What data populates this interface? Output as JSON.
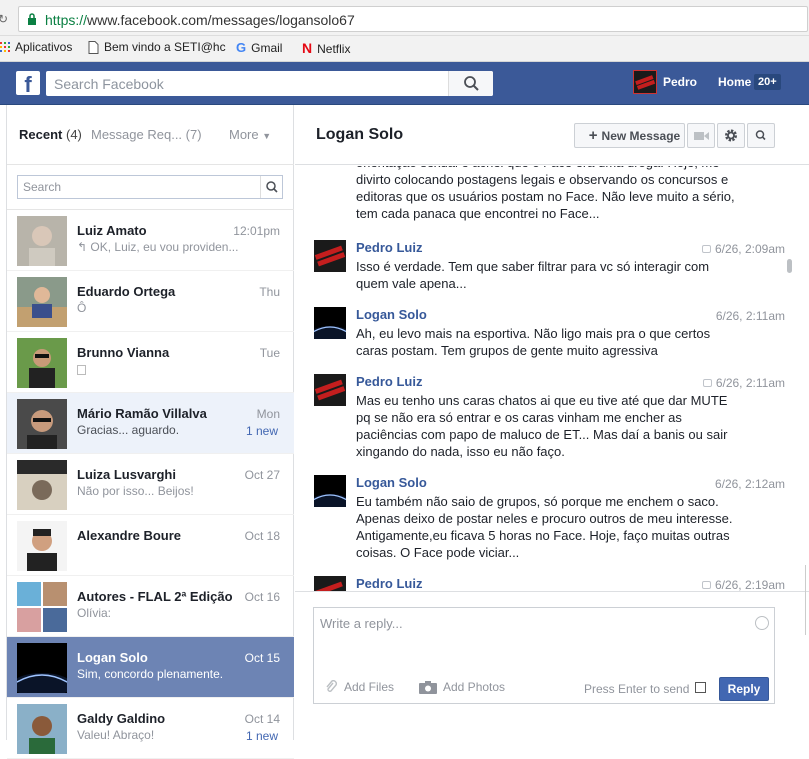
{
  "browser": {
    "url_scheme": "https://",
    "url_rest": "www.facebook.com/messages/logansolo67",
    "bookmarks": [
      "Aplicativos",
      "Bem vindo a SETI@hc",
      "Gmail",
      "Netflix"
    ]
  },
  "header": {
    "search_placeholder": "Search Facebook",
    "user_name": "Pedro",
    "home_label": "Home",
    "home_badge": "20+"
  },
  "sidebar": {
    "tab_recent": "Recent",
    "tab_recent_count": "(4)",
    "tab_requests": "Message Req... (7)",
    "tab_more": "More",
    "search_placeholder": "Search",
    "threads": [
      {
        "name": "Luiz Amato",
        "snippet": "OK, Luiz, eu vou providen...",
        "time": "12:01pm",
        "new": ""
      },
      {
        "name": "Eduardo Ortega",
        "snippet": "Ô",
        "time": "Thu",
        "new": ""
      },
      {
        "name": "Brunno Vianna",
        "snippet": "",
        "time": "Tue",
        "new": ""
      },
      {
        "name": "Mário Ramão Villalva",
        "snippet": "Gracias... aguardo.",
        "time": "Mon",
        "new": "1 new"
      },
      {
        "name": "Luiza Lusvarghi",
        "snippet": "Não por isso... Beijos!",
        "time": "Oct 27",
        "new": ""
      },
      {
        "name": "Alexandre Boure",
        "snippet": "",
        "time": "Oct 18",
        "new": ""
      },
      {
        "name": "Autores - FLAL 2ª Edição",
        "snippet": "Olívia:",
        "time": "Oct 16",
        "new": ""
      },
      {
        "name": "Logan Solo",
        "snippet": "Sim, concordo plenamente.",
        "time": "Oct 15",
        "new": ""
      },
      {
        "name": "Galdy Galdino",
        "snippet": "Valeu! Abraço!",
        "time": "Oct 14",
        "new": "1 new"
      }
    ]
  },
  "conversation": {
    "title": "Logan Solo",
    "new_message_label": "New Message",
    "messages": [
      {
        "sender": "",
        "time": "",
        "text": "orientação sexual e achei que o Face era uma droga. Hoje, me divirto colocando postagens legais e observando os concursos e editoras que os usuários postam no Face. Não leve muito a sério, tem cada panaca que encontrei no Face..."
      },
      {
        "sender": "Pedro Luiz",
        "time": "6/26, 2:09am",
        "text": "Isso é verdade. Tem que saber filtrar para vc só interagir com quem vale apena..."
      },
      {
        "sender": "Logan Solo",
        "time": "6/26, 2:11am",
        "text": "Ah, eu levo mais na esportiva. Não ligo mais pra o que certos caras postam. Tem grupos de gente muito agressiva"
      },
      {
        "sender": "Pedro Luiz",
        "time": "6/26, 2:11am",
        "text": "Mas eu tenho uns caras chatos ai que eu tive até que dar MUTE pq se não era só entrar e os caras vinham me encher as paciências com papo de maluco de ET... Mas daí a banis ou sair xingando do nada, isso eu não faço."
      },
      {
        "sender": "Logan Solo",
        "time": "6/26, 2:12am",
        "text": "Eu também não saio de grupos, só porque me enchem o saco. Apenas deixo de postar neles e procuro outros de meu interesse. Antigamente,eu ficava 5 horas no Face. Hoje, faço muitas outras coisas. O Face pode viciar..."
      },
      {
        "sender": "Pedro Luiz",
        "time": "6/26, 2:19am",
        "text": ""
      }
    ],
    "reply_placeholder": "Write a reply...",
    "add_files": "Add Files",
    "add_photos": "Add Photos",
    "press_enter": "Press Enter to send",
    "reply_button": "Reply"
  }
}
